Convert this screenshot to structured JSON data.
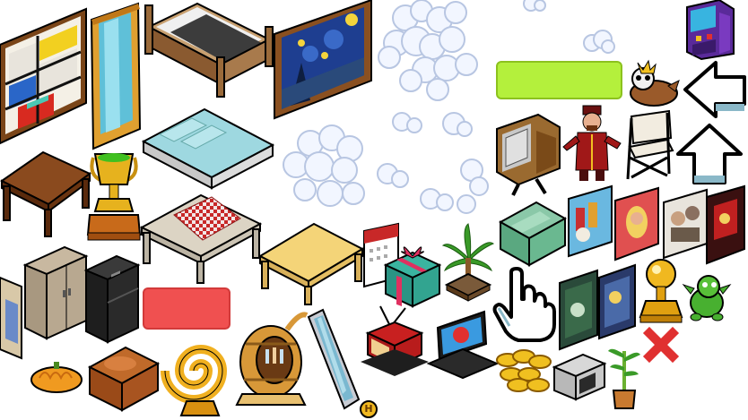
{
  "sprite_sheet": {
    "items": [
      {
        "id": "mondrian-painting",
        "name": "mondrian-painting-icon"
      },
      {
        "id": "mirror-tall",
        "name": "standing-mirror-icon"
      },
      {
        "id": "dark-bed",
        "name": "dark-bed-icon"
      },
      {
        "id": "starry-night",
        "name": "starry-night-painting-icon"
      },
      {
        "id": "cloud",
        "name": "cloud-icon"
      },
      {
        "id": "arcade",
        "name": "arcade-machine-icon"
      },
      {
        "id": "duck-pet",
        "name": "duck-pet-icon"
      },
      {
        "id": "white-bed",
        "name": "white-bed-icon"
      },
      {
        "id": "wood-table",
        "name": "wood-table-icon"
      },
      {
        "id": "trophy",
        "name": "gold-trophy-icon"
      },
      {
        "id": "checker-table",
        "name": "checkered-table-icon"
      },
      {
        "id": "retro-tv",
        "name": "retro-tv-icon"
      },
      {
        "id": "host-avatar",
        "name": "host-avatar-icon"
      },
      {
        "id": "directors-chair",
        "name": "directors-chair-icon"
      },
      {
        "id": "green-armchair",
        "name": "green-armchair-icon"
      },
      {
        "id": "posters",
        "name": "poster-icon"
      },
      {
        "id": "light-table",
        "name": "light-wood-table-icon"
      },
      {
        "id": "calendar",
        "name": "calendar-icon"
      },
      {
        "id": "gift",
        "name": "gift-box-icon"
      },
      {
        "id": "palm",
        "name": "palm-plant-icon"
      },
      {
        "id": "cabinet",
        "name": "cabinet-icon"
      },
      {
        "id": "black-fridge",
        "name": "black-fridge-icon"
      },
      {
        "id": "hand",
        "name": "hand-cursor-icon"
      },
      {
        "id": "gold-ball",
        "name": "gold-statue-icon"
      },
      {
        "id": "dragon",
        "name": "green-dragon-icon"
      },
      {
        "id": "close",
        "name": "red-x-icon"
      },
      {
        "id": "pumpkin",
        "name": "pumpkin-icon"
      },
      {
        "id": "brown-armchair",
        "name": "brown-armchair-icon"
      },
      {
        "id": "gold-swirl",
        "name": "gold-swirl-icon"
      },
      {
        "id": "barrel-bar",
        "name": "barrel-bar-icon"
      },
      {
        "id": "floor-mirror",
        "name": "floor-mirror-icon"
      },
      {
        "id": "red-tv",
        "name": "red-tv-icon"
      },
      {
        "id": "flat-tv",
        "name": "flat-tv-icon"
      },
      {
        "id": "coins",
        "name": "gold-coins-icon"
      },
      {
        "id": "microwave",
        "name": "microwave-icon"
      },
      {
        "id": "bamboo",
        "name": "bamboo-plant-icon"
      },
      {
        "id": "h-coin",
        "name": "habbo-coin-icon"
      }
    ],
    "h_coin_letter": "H"
  },
  "buttons": {
    "green": {
      "color": "#b4f03c",
      "border": "#8cc21e"
    },
    "red": {
      "color": "#f05050",
      "border": "#d23a3a"
    }
  },
  "arrows": {
    "left": "arrow-left-icon",
    "up": "arrow-up-icon"
  },
  "colors": {
    "outline": "#000000",
    "wood": "#8a4a1e",
    "gold": "#e6b21e",
    "cloud": "#f2f6ff",
    "cloud_shade": "#c9d4ea"
  }
}
